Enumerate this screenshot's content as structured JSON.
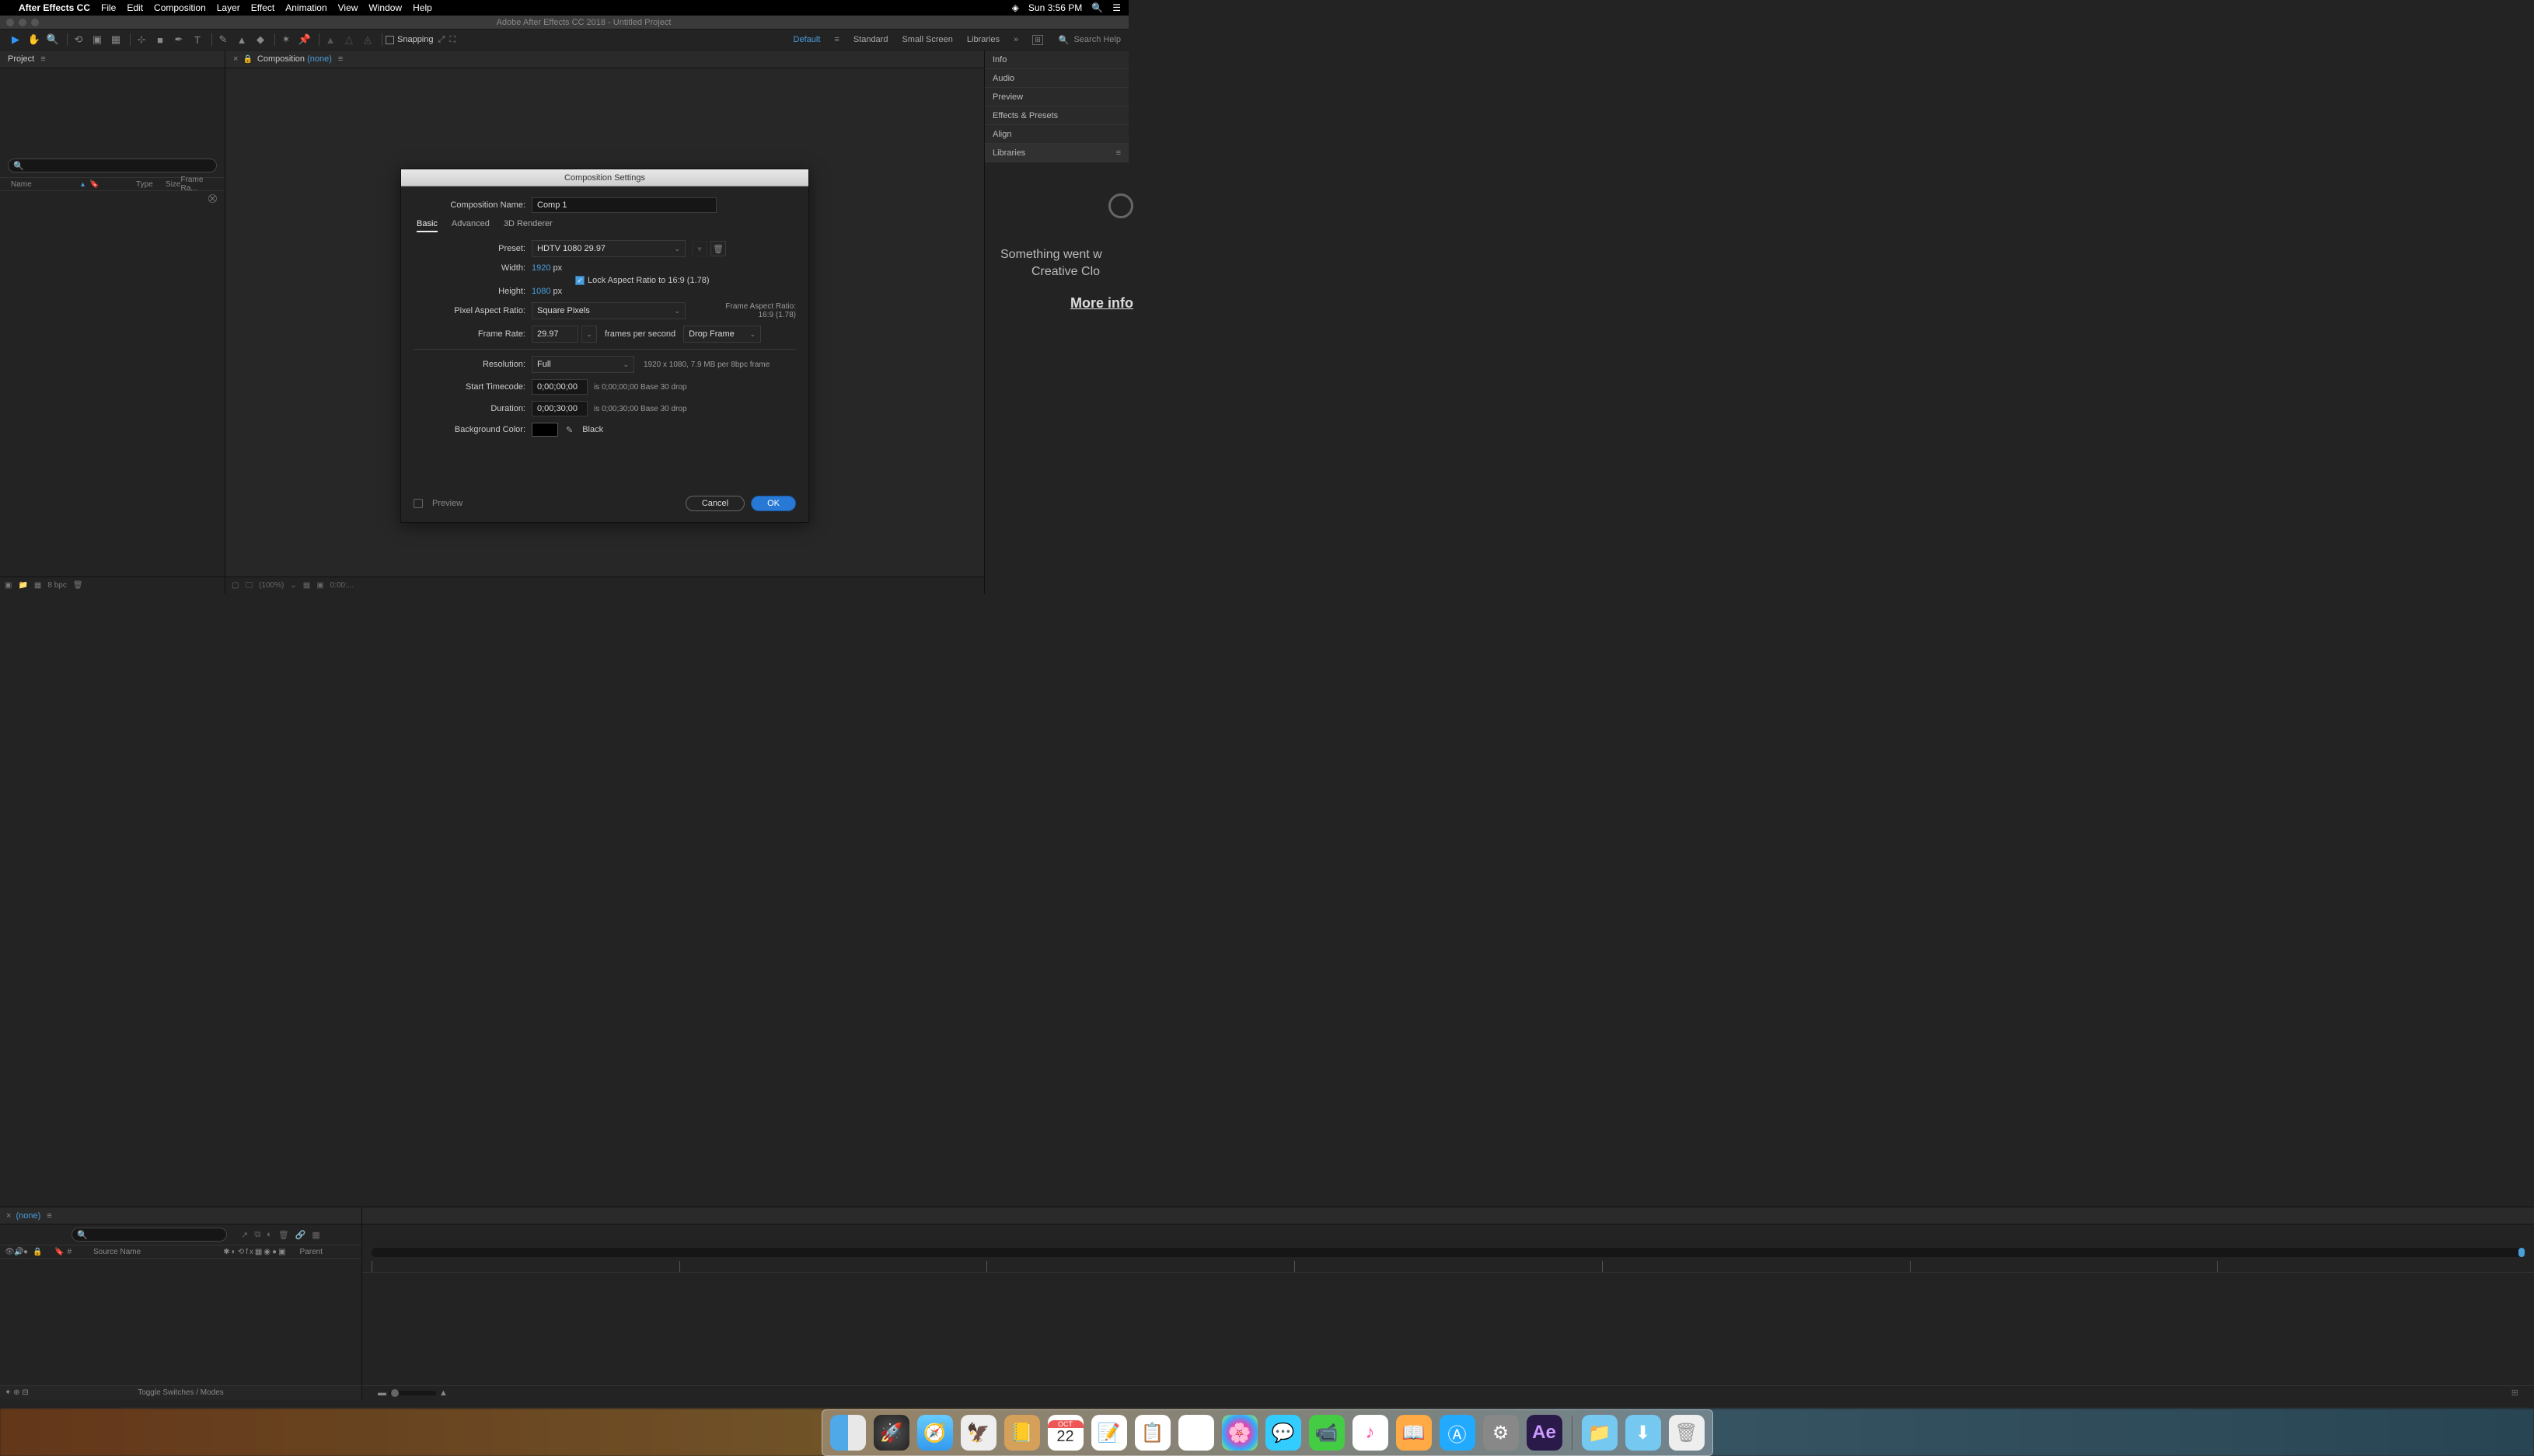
{
  "menubar": {
    "app_name": "After Effects CC",
    "items": [
      "File",
      "Edit",
      "Composition",
      "Layer",
      "Effect",
      "Animation",
      "View",
      "Window",
      "Help"
    ],
    "clock": "Sun 3:56 PM"
  },
  "window_title": "Adobe After Effects CC 2018 - Untitled Project",
  "toolbar": {
    "snapping": "Snapping",
    "workspaces": [
      "Default",
      "Standard",
      "Small Screen",
      "Libraries"
    ],
    "search_placeholder": "Search Help"
  },
  "project_panel": {
    "title": "Project",
    "columns": [
      "Name",
      "Type",
      "Size",
      "Frame Ra..."
    ],
    "footer_bpc": "8 bpc"
  },
  "comp_panel": {
    "label": "Composition",
    "none": "(none)",
    "zoom": "(100%)",
    "time": "0:00:..."
  },
  "right_tabs": [
    "Info",
    "Audio",
    "Preview",
    "Effects & Presets",
    "Align",
    "Libraries"
  ],
  "libraries": {
    "err1": "Something went w",
    "err2": "Creative Clo",
    "link": "More info"
  },
  "timeline": {
    "none": "(none)",
    "cols_source": "Source Name",
    "cols_parent": "Parent",
    "footer": "Toggle Switches / Modes"
  },
  "dialog": {
    "title": "Composition Settings",
    "name_label": "Composition Name:",
    "name_value": "Comp 1",
    "tabs": [
      "Basic",
      "Advanced",
      "3D Renderer"
    ],
    "preset_label": "Preset:",
    "preset_value": "HDTV 1080 29.97",
    "width_label": "Width:",
    "width_value": "1920",
    "height_label": "Height:",
    "height_value": "1080",
    "px": "px",
    "lock_ar": "Lock Aspect Ratio to 16:9 (1.78)",
    "par_label": "Pixel Aspect Ratio:",
    "par_value": "Square Pixels",
    "far_label": "Frame Aspect Ratio:",
    "far_value": "16:9 (1.78)",
    "fr_label": "Frame Rate:",
    "fr_value": "29.97",
    "fps": "frames per second",
    "dropframe": "Drop Frame",
    "res_label": "Resolution:",
    "res_value": "Full",
    "res_hint": "1920 x 1080, 7.9 MB per 8bpc frame",
    "stc_label": "Start Timecode:",
    "stc_value": "0;00;00;00",
    "stc_hint": "is 0;00;00;00  Base 30  drop",
    "dur_label": "Duration:",
    "dur_value": "0;00;30;00",
    "dur_hint": "is 0;00;30;00  Base 30  drop",
    "bg_label": "Background Color:",
    "bg_name": "Black",
    "preview": "Preview",
    "cancel": "Cancel",
    "ok": "OK"
  },
  "dock": {
    "date_month": "OCT",
    "date_day": "22"
  }
}
